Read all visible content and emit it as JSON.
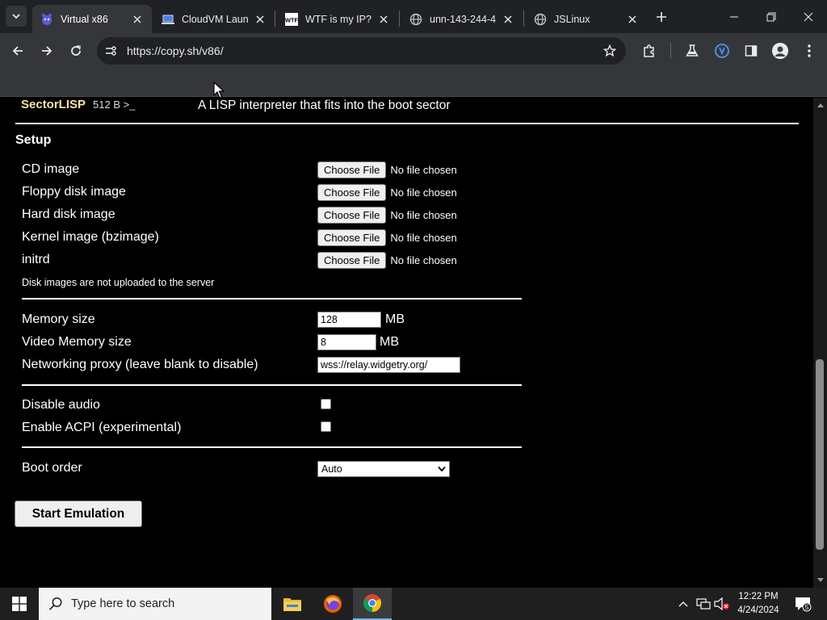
{
  "browser": {
    "tabs": [
      {
        "title": "Virtual x86",
        "active": true,
        "icon": "v86-icon"
      },
      {
        "title": "CloudVM Laun",
        "active": false,
        "icon": "laptop-icon"
      },
      {
        "title": "WTF is my IP?!",
        "active": false,
        "icon": "wtf-icon"
      },
      {
        "title": "unn-143-244-4",
        "active": false,
        "icon": "globe-icon"
      },
      {
        "title": "JSLinux",
        "active": false,
        "icon": "globe-icon"
      }
    ],
    "url": "https://copy.sh/v86/",
    "wtf_favicon_text": "WTF"
  },
  "page": {
    "os_entry": {
      "name": "SectorLISP",
      "size": "512 B >_",
      "description": "A LISP interpreter that fits into the boot sector"
    },
    "setup_title": "Setup",
    "file_rows": [
      {
        "label": "CD image",
        "button": "Choose File",
        "status": "No file chosen"
      },
      {
        "label": "Floppy disk image",
        "button": "Choose File",
        "status": "No file chosen"
      },
      {
        "label": "Hard disk image",
        "button": "Choose File",
        "status": "No file chosen"
      },
      {
        "label": "Kernel image (bzimage)",
        "button": "Choose File",
        "status": "No file chosen"
      },
      {
        "label": "initrd",
        "button": "Choose File",
        "status": "No file chosen"
      }
    ],
    "upload_note": "Disk images are not uploaded to the server",
    "memory": {
      "label": "Memory size",
      "value": "128",
      "unit": "MB"
    },
    "video_memory": {
      "label": "Video Memory size",
      "value": "8",
      "unit": "MB"
    },
    "proxy": {
      "label": "Networking proxy (leave blank to disable)",
      "value": "wss://relay.widgetry.org/"
    },
    "disable_audio": {
      "label": "Disable audio",
      "checked": false
    },
    "enable_acpi": {
      "label": "Enable ACPI (experimental)",
      "checked": false
    },
    "boot_order": {
      "label": "Boot order",
      "selected": "Auto"
    },
    "start_button": "Start Emulation"
  },
  "taskbar": {
    "search_placeholder": "Type here to search",
    "time": "12:22 PM",
    "date": "4/24/2024",
    "notification_count": "5",
    "apps": [
      "file-explorer-icon",
      "firefox-icon",
      "chrome-icon"
    ]
  },
  "colors": {
    "os_name": "#f6e1a8",
    "page_bg": "#000000",
    "chrome_dark": "#202124",
    "chrome_toolbar": "#35363a"
  }
}
